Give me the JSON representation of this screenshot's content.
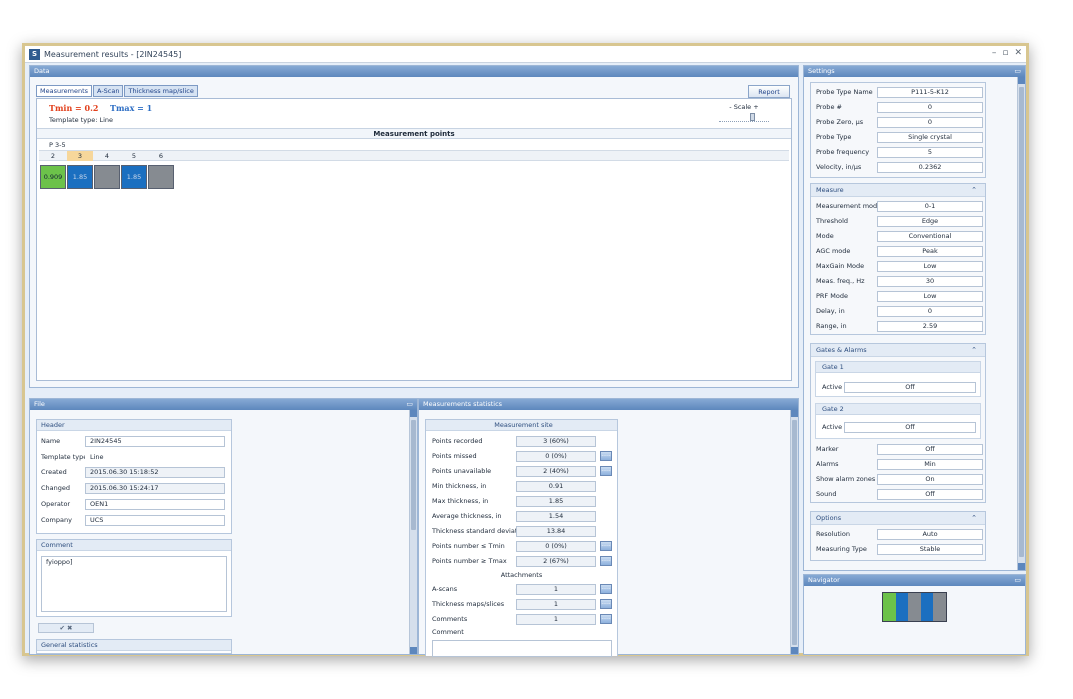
{
  "window": {
    "title": "Measurement results - [2IN24545]",
    "controls": [
      "–",
      "▫",
      "✕"
    ]
  },
  "data_panel": {
    "header": "Data",
    "tabs": [
      "Measurements",
      "A-Scan",
      "Thickness map/slice"
    ],
    "report_label": "Report",
    "tmin": "Tmin = 0.2",
    "tmax": "Tmax = 1",
    "template_type": "Template type: Line",
    "scale_label": "- Scale +",
    "section_title": "Measurement points",
    "row_label": "P 3-5",
    "columns": [
      "2",
      "3",
      "4",
      "5",
      "6"
    ],
    "cells": [
      "0.909",
      "1.85",
      "",
      "1.85",
      ""
    ]
  },
  "file_panel": {
    "header": "File",
    "header_group": "Header",
    "fields": [
      {
        "label": "Name",
        "value": "2IN24545"
      },
      {
        "label": "Template type",
        "value": "Line"
      },
      {
        "label": "Created",
        "value": "2015.06.30 15:18:52"
      },
      {
        "label": "Changed",
        "value": "2015.06.30 15:24:17"
      },
      {
        "label": "Operator",
        "value": "OEN1"
      },
      {
        "label": "Company",
        "value": "UCS"
      }
    ],
    "comment_group": "Comment",
    "comment_text": "fyioppo]",
    "ok_cancel": "✔   ✖",
    "general_stats": "General statistics"
  },
  "stats_panel": {
    "header": "Measurements statistics",
    "site_title": "Measurement site",
    "rows": [
      {
        "label": "Points recorded",
        "value": "3 (60%)",
        "btn": false
      },
      {
        "label": "Points missed",
        "value": "0 (0%)",
        "btn": true
      },
      {
        "label": "Points unavailable",
        "value": "2 (40%)",
        "btn": true
      },
      {
        "label": "Min thickness, in",
        "value": "0.91",
        "btn": false
      },
      {
        "label": "Max thickness, in",
        "value": "1.85",
        "btn": false
      },
      {
        "label": "Average thickness, in",
        "value": "1.54",
        "btn": false
      },
      {
        "label": "Thickness standard deviation",
        "value": "13.84",
        "btn": false
      },
      {
        "label": "Points number ≤ Tmin",
        "value": "0 (0%)",
        "btn": true
      },
      {
        "label": "Points number ≥ Tmax",
        "value": "2 (67%)",
        "btn": true
      }
    ],
    "attachments_title": "Attachments",
    "attachments": [
      {
        "label": "A-scans",
        "value": "1"
      },
      {
        "label": "Thickness maps/slices",
        "value": "1"
      },
      {
        "label": "Comments",
        "value": "1"
      }
    ],
    "comment_label": "Comment",
    "dots": "....."
  },
  "settings_panel": {
    "header": "Settings",
    "probe": [
      {
        "label": "Probe Type Name",
        "value": "P111-5-K12"
      },
      {
        "label": "Probe #",
        "value": "0"
      },
      {
        "label": "Probe Zero, µs",
        "value": "0"
      },
      {
        "label": "Probe Type",
        "value": "Single crystal"
      },
      {
        "label": "Probe frequency",
        "value": "5"
      },
      {
        "label": "Velocity, in/µs",
        "value": "0.2362"
      }
    ],
    "measure_title": "Measure",
    "measure": [
      {
        "label": "Measurement mode",
        "value": "0-1"
      },
      {
        "label": "Threshold",
        "value": "Edge"
      },
      {
        "label": "Mode",
        "value": "Conventional"
      },
      {
        "label": "AGC mode",
        "value": "Peak"
      },
      {
        "label": "MaxGain Mode",
        "value": "Low"
      },
      {
        "label": "Meas. freq., Hz",
        "value": "30"
      },
      {
        "label": "PRF Mode",
        "value": "Low"
      },
      {
        "label": "Delay, in",
        "value": "0"
      },
      {
        "label": "Range, in",
        "value": "2.59"
      }
    ],
    "gates_title": "Gates & Alarms",
    "gate1_title": "Gate 1",
    "gate2_title": "Gate 2",
    "active_label": "Active",
    "gate1_active": "Off",
    "gate2_active": "Off",
    "alarms": [
      {
        "label": "Marker",
        "value": "Off"
      },
      {
        "label": "Alarms",
        "value": "Min"
      },
      {
        "label": "Show alarm zones",
        "value": "On"
      },
      {
        "label": "Sound",
        "value": "Off"
      }
    ],
    "options_title": "Options",
    "options": [
      {
        "label": "Resolution",
        "value": "Auto"
      },
      {
        "label": "Measuring Type",
        "value": "Stable"
      }
    ],
    "collapse_glyph": "⌃"
  },
  "navigator_panel": {
    "header": "Navigator"
  },
  "colors": {
    "green": "#6cc24a",
    "blue": "#1b6fc0",
    "gray": "#868b91",
    "header": "#5d87bd",
    "tmin": "#e2401c",
    "tmax": "#2d6ec4"
  }
}
